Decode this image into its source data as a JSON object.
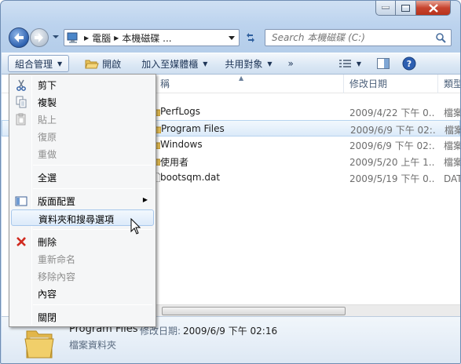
{
  "breadcrumb": [
    "電腦",
    "本機磁碟 ..."
  ],
  "search": {
    "placeholder": "Search 本機磁碟 (C:)"
  },
  "toolbar": {
    "organize": "組合管理",
    "open": "開啟",
    "include": "加入至媒體櫃",
    "share": "共用對象",
    "more": "»"
  },
  "columns": {
    "name": "稱",
    "date": "修改日期",
    "type": "類型"
  },
  "files": [
    {
      "name": "PerfLogs",
      "date": "2009/4/22 下午 0...",
      "type": "檔案資料夾",
      "selected": false,
      "kind": "folder"
    },
    {
      "name": "Program Files",
      "date": "2009/6/9 下午 02:...",
      "type": "檔案資料夾",
      "selected": true,
      "kind": "folder"
    },
    {
      "name": "Windows",
      "date": "2009/6/9 下午 02:...",
      "type": "檔案資料夾",
      "selected": false,
      "kind": "folder"
    },
    {
      "name": "使用者",
      "date": "2009/5/20 上午 1...",
      "type": "檔案資料夾",
      "selected": false,
      "kind": "folder"
    },
    {
      "name": "bootsqm.dat",
      "date": "2009/5/19 下午 0...",
      "type": "DAT 檔案",
      "selected": false,
      "kind": "file"
    }
  ],
  "details": {
    "name": "Program Files",
    "modified_label": "修改日期:",
    "modified_value": "2009/6/9 下午 02:16",
    "type": "檔案資料夾"
  },
  "menu": {
    "cut": "剪下",
    "copy": "複製",
    "paste": "貼上",
    "undo": "復原",
    "redo": "重做",
    "select_all": "全選",
    "layout": "版面配置",
    "folder_options": "資料夾和搜尋選項",
    "delete": "刪除",
    "rename": "重新命名",
    "remove_props": "移除內容",
    "properties": "內容",
    "close": "關閉"
  },
  "colors": {
    "accent": "#2f62b0",
    "selection": "#dbeaf9",
    "close": "#c7442f"
  }
}
